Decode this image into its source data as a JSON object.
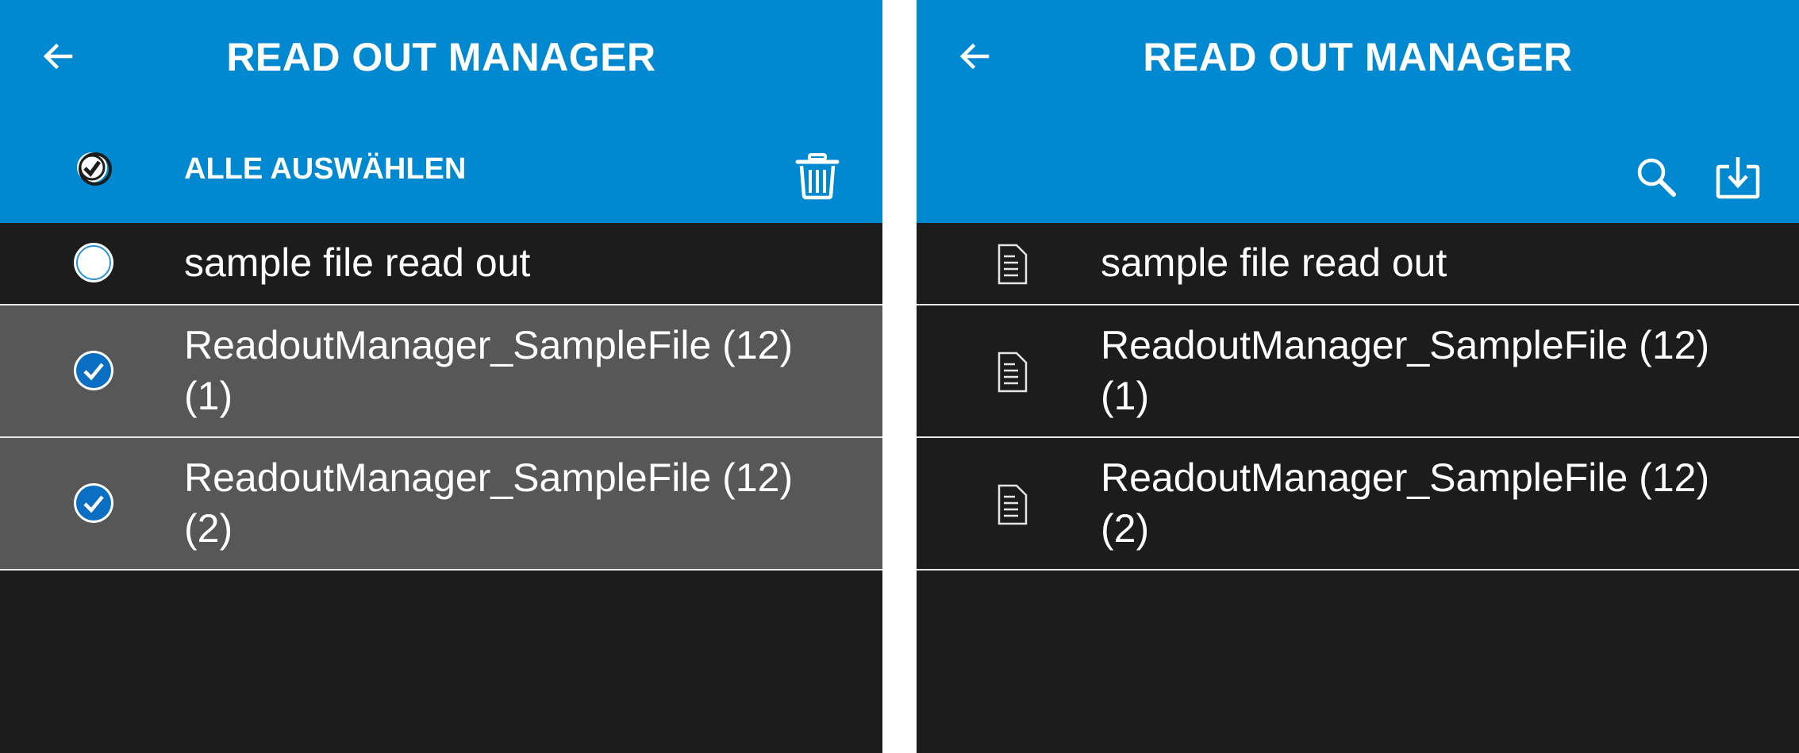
{
  "left_screen": {
    "title": "READ OUT MANAGER",
    "select_all_label": "ALLE AUSWÄHLEN",
    "files": [
      {
        "name": "sample file read out",
        "selected": false
      },
      {
        "name": "ReadoutManager_SampleFile (12) (1)",
        "selected": true
      },
      {
        "name": "ReadoutManager_SampleFile (12) (2)",
        "selected": true
      }
    ]
  },
  "right_screen": {
    "title": "READ OUT MANAGER",
    "files": [
      {
        "name": "sample file read out"
      },
      {
        "name": "ReadoutManager_SampleFile (12) (1)"
      },
      {
        "name": "ReadoutManager_SampleFile (12) (2)"
      }
    ]
  },
  "colors": {
    "app_bar": "#0088d1",
    "background": "#1c1c1c",
    "selected_row": "#575757",
    "divider": "#e8e8e8",
    "text": "#ffffff",
    "check_accent": "#0a6fc2"
  },
  "icons": {
    "back": "arrow-left-icon",
    "select_all": "check-circle-icon",
    "delete": "trash-icon",
    "search": "search-icon",
    "download": "download-icon",
    "file": "document-icon",
    "unchecked": "radio-unchecked-icon",
    "checked": "radio-checked-icon"
  }
}
